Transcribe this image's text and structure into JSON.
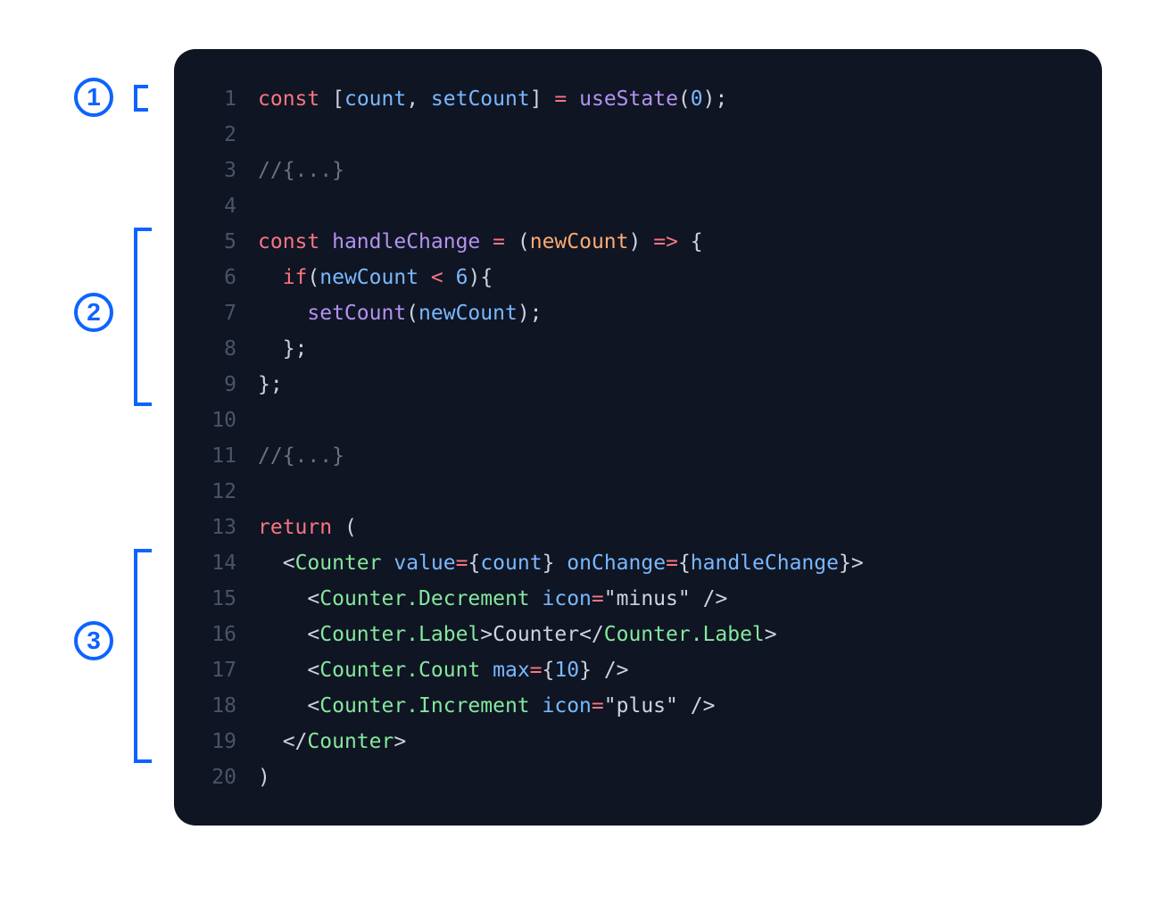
{
  "annotations": {
    "badge1": "1",
    "badge2": "2",
    "badge3": "3"
  },
  "colors": {
    "accent": "#0d63ff",
    "editor_bg": "#0f1523"
  },
  "code": {
    "lines": [
      {
        "n": "1",
        "tokens": [
          {
            "c": "tok-keyword",
            "t": "const"
          },
          {
            "c": "tok-default",
            "t": " "
          },
          {
            "c": "tok-punct",
            "t": "["
          },
          {
            "c": "tok-var",
            "t": "count"
          },
          {
            "c": "tok-punct",
            "t": ", "
          },
          {
            "c": "tok-var",
            "t": "setCount"
          },
          {
            "c": "tok-punct",
            "t": "]"
          },
          {
            "c": "tok-default",
            "t": " "
          },
          {
            "c": "tok-eq",
            "t": "="
          },
          {
            "c": "tok-default",
            "t": " "
          },
          {
            "c": "tok-func",
            "t": "useState"
          },
          {
            "c": "tok-punct",
            "t": "("
          },
          {
            "c": "tok-num",
            "t": "0"
          },
          {
            "c": "tok-punct",
            "t": ");"
          }
        ]
      },
      {
        "n": "2",
        "tokens": []
      },
      {
        "n": "3",
        "tokens": [
          {
            "c": "tok-comment",
            "t": "//{...}"
          }
        ]
      },
      {
        "n": "4",
        "tokens": []
      },
      {
        "n": "5",
        "tokens": [
          {
            "c": "tok-keyword",
            "t": "const"
          },
          {
            "c": "tok-default",
            "t": " "
          },
          {
            "c": "tok-func",
            "t": "handleChange"
          },
          {
            "c": "tok-default",
            "t": " "
          },
          {
            "c": "tok-eq",
            "t": "="
          },
          {
            "c": "tok-default",
            "t": " "
          },
          {
            "c": "tok-punct",
            "t": "("
          },
          {
            "c": "tok-param",
            "t": "newCount"
          },
          {
            "c": "tok-punct",
            "t": ")"
          },
          {
            "c": "tok-default",
            "t": " "
          },
          {
            "c": "tok-eq",
            "t": "=>"
          },
          {
            "c": "tok-default",
            "t": " "
          },
          {
            "c": "tok-punct",
            "t": "{"
          }
        ]
      },
      {
        "n": "6",
        "tokens": [
          {
            "c": "tok-default",
            "t": "  "
          },
          {
            "c": "tok-keyword",
            "t": "if"
          },
          {
            "c": "tok-punct",
            "t": "("
          },
          {
            "c": "tok-var",
            "t": "newCount"
          },
          {
            "c": "tok-default",
            "t": " "
          },
          {
            "c": "tok-eq",
            "t": "<"
          },
          {
            "c": "tok-default",
            "t": " "
          },
          {
            "c": "tok-num",
            "t": "6"
          },
          {
            "c": "tok-punct",
            "t": "){"
          }
        ]
      },
      {
        "n": "7",
        "tokens": [
          {
            "c": "tok-default",
            "t": "    "
          },
          {
            "c": "tok-func",
            "t": "setCount"
          },
          {
            "c": "tok-punct",
            "t": "("
          },
          {
            "c": "tok-var",
            "t": "newCount"
          },
          {
            "c": "tok-punct",
            "t": ");"
          }
        ]
      },
      {
        "n": "8",
        "tokens": [
          {
            "c": "tok-default",
            "t": "  "
          },
          {
            "c": "tok-punct",
            "t": "};"
          }
        ]
      },
      {
        "n": "9",
        "tokens": [
          {
            "c": "tok-punct",
            "t": "};"
          }
        ]
      },
      {
        "n": "10",
        "tokens": []
      },
      {
        "n": "11",
        "tokens": [
          {
            "c": "tok-comment",
            "t": "//{...}"
          }
        ]
      },
      {
        "n": "12",
        "tokens": []
      },
      {
        "n": "13",
        "tokens": [
          {
            "c": "tok-keyword",
            "t": "return"
          },
          {
            "c": "tok-default",
            "t": " "
          },
          {
            "c": "tok-punct",
            "t": "("
          }
        ]
      },
      {
        "n": "14",
        "tokens": [
          {
            "c": "tok-default",
            "t": "  "
          },
          {
            "c": "tok-angle",
            "t": "<"
          },
          {
            "c": "tok-tag",
            "t": "Counter"
          },
          {
            "c": "tok-default",
            "t": " "
          },
          {
            "c": "tok-prop",
            "t": "value"
          },
          {
            "c": "tok-eq",
            "t": "="
          },
          {
            "c": "tok-punct",
            "t": "{"
          },
          {
            "c": "tok-var",
            "t": "count"
          },
          {
            "c": "tok-punct",
            "t": "}"
          },
          {
            "c": "tok-default",
            "t": " "
          },
          {
            "c": "tok-prop",
            "t": "onChange"
          },
          {
            "c": "tok-eq",
            "t": "="
          },
          {
            "c": "tok-punct",
            "t": "{"
          },
          {
            "c": "tok-var",
            "t": "handleChange"
          },
          {
            "c": "tok-punct",
            "t": "}"
          },
          {
            "c": "tok-angle",
            "t": ">"
          }
        ]
      },
      {
        "n": "15",
        "tokens": [
          {
            "c": "tok-default",
            "t": "    "
          },
          {
            "c": "tok-angle",
            "t": "<"
          },
          {
            "c": "tok-tag",
            "t": "Counter.Decrement"
          },
          {
            "c": "tok-default",
            "t": " "
          },
          {
            "c": "tok-prop",
            "t": "icon"
          },
          {
            "c": "tok-eq",
            "t": "="
          },
          {
            "c": "tok-punct",
            "t": "\""
          },
          {
            "c": "tok-string",
            "t": "minus"
          },
          {
            "c": "tok-punct",
            "t": "\""
          },
          {
            "c": "tok-default",
            "t": " "
          },
          {
            "c": "tok-angle",
            "t": "/>"
          }
        ]
      },
      {
        "n": "16",
        "tokens": [
          {
            "c": "tok-default",
            "t": "    "
          },
          {
            "c": "tok-angle",
            "t": "<"
          },
          {
            "c": "tok-tag",
            "t": "Counter.Label"
          },
          {
            "c": "tok-angle",
            "t": ">"
          },
          {
            "c": "tok-default",
            "t": "Counter"
          },
          {
            "c": "tok-angle",
            "t": "</"
          },
          {
            "c": "tok-tag",
            "t": "Counter.Label"
          },
          {
            "c": "tok-angle",
            "t": ">"
          }
        ]
      },
      {
        "n": "17",
        "tokens": [
          {
            "c": "tok-default",
            "t": "    "
          },
          {
            "c": "tok-angle",
            "t": "<"
          },
          {
            "c": "tok-tag",
            "t": "Counter.Count"
          },
          {
            "c": "tok-default",
            "t": " "
          },
          {
            "c": "tok-prop",
            "t": "max"
          },
          {
            "c": "tok-eq",
            "t": "="
          },
          {
            "c": "tok-punct",
            "t": "{"
          },
          {
            "c": "tok-num",
            "t": "10"
          },
          {
            "c": "tok-punct",
            "t": "}"
          },
          {
            "c": "tok-default",
            "t": " "
          },
          {
            "c": "tok-angle",
            "t": "/>"
          }
        ]
      },
      {
        "n": "18",
        "tokens": [
          {
            "c": "tok-default",
            "t": "    "
          },
          {
            "c": "tok-angle",
            "t": "<"
          },
          {
            "c": "tok-tag",
            "t": "Counter.Increment"
          },
          {
            "c": "tok-default",
            "t": " "
          },
          {
            "c": "tok-prop",
            "t": "icon"
          },
          {
            "c": "tok-eq",
            "t": "="
          },
          {
            "c": "tok-punct",
            "t": "\""
          },
          {
            "c": "tok-string",
            "t": "plus"
          },
          {
            "c": "tok-punct",
            "t": "\""
          },
          {
            "c": "tok-default",
            "t": " "
          },
          {
            "c": "tok-angle",
            "t": "/>"
          }
        ]
      },
      {
        "n": "19",
        "tokens": [
          {
            "c": "tok-default",
            "t": "  "
          },
          {
            "c": "tok-angle",
            "t": "</"
          },
          {
            "c": "tok-tag",
            "t": "Counter"
          },
          {
            "c": "tok-angle",
            "t": ">"
          }
        ]
      },
      {
        "n": "20",
        "tokens": [
          {
            "c": "tok-punct",
            "t": ")"
          }
        ]
      }
    ]
  }
}
